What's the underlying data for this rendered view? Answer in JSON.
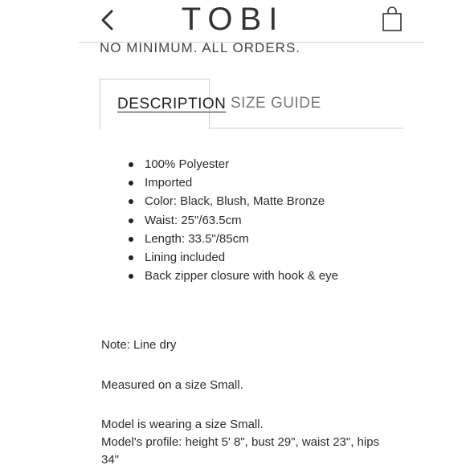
{
  "header": {
    "brand": "TOBI",
    "back_icon": "chevron-left-icon",
    "bag_icon": "shopping-bag-icon"
  },
  "promo": "NO MINIMUM. ALL ORDERS.",
  "tabs": [
    {
      "label": "DESCRIPTION",
      "active": true
    },
    {
      "label": "SIZE GUIDE",
      "active": false
    }
  ],
  "features": [
    "100% Polyester",
    "Imported",
    "Color: Black, Blush, Matte Bronze",
    "Waist: 25\"/63.5cm",
    "Length: 33.5\"/85cm",
    "Lining included",
    "Back zipper closure with hook & eye"
  ],
  "notes": {
    "care": "Note: Line dry",
    "measured": "Measured on a size Small.",
    "model_size": "Model is wearing a size Small.",
    "model_profile_line1": "Model's profile: height 5' 8\", bust 29\", waist 23\", hips",
    "model_profile_line2": "34\""
  }
}
